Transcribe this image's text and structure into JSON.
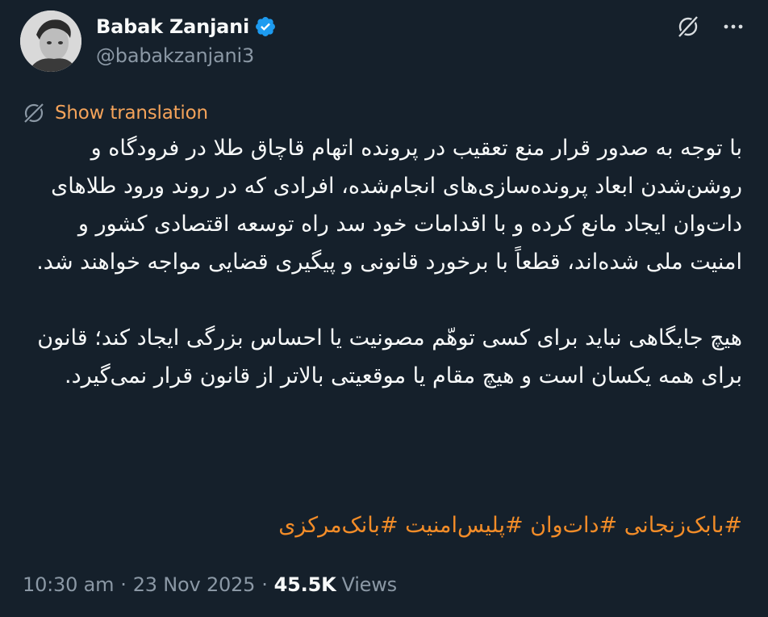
{
  "author": {
    "display_name": "Babak Zanjani",
    "handle": "@babakzanjani3",
    "verified": true
  },
  "header_icons": [
    "grok-icon",
    "more-icon"
  ],
  "translate": {
    "icon": "globe-icon",
    "label": "Show translation"
  },
  "tweet": {
    "paragraph_1": "با توجه به صدور قرار منع تعقیب در پرونده اتهام قاچاق طلا در فرودگاه و روشن‌شدن ابعاد پرونده‌سازی‌های انجام‌شده، افرادی که در روند ورود طلاهای دات‌وان ایجاد مانع کرده و با اقدامات خود سد راه توسعه اقتصادی کشور و امنیت ملی شده‌اند، قطعاً با برخورد قانونی و پیگیری قضایی مواجه خواهند شد.",
    "paragraph_2": "هیچ جایگاهی نباید برای کسی توهّم مصونیت یا احساس بزرگی ایجاد کند؛ قانون برای همه یکسان است و هیچ مقام یا موقعیتی بالاتر از قانون قرار نمی‌گیرد.",
    "hashtags": [
      "#بابک‌زنجانی",
      "#دات‌وان",
      "#پلیس‌امنیت",
      "#بانک‌مرکزی"
    ]
  },
  "meta": {
    "time": "10:30 am",
    "separator": "·",
    "date": "23 Nov 2025",
    "views_count": "45.5K",
    "views_label": "Views"
  },
  "colors": {
    "background": "#15202b",
    "text_primary": "#f7f9f9",
    "text_secondary": "#8b98a5",
    "accent_orange": "#f28c28",
    "verified_blue": "#1d9bf0"
  }
}
